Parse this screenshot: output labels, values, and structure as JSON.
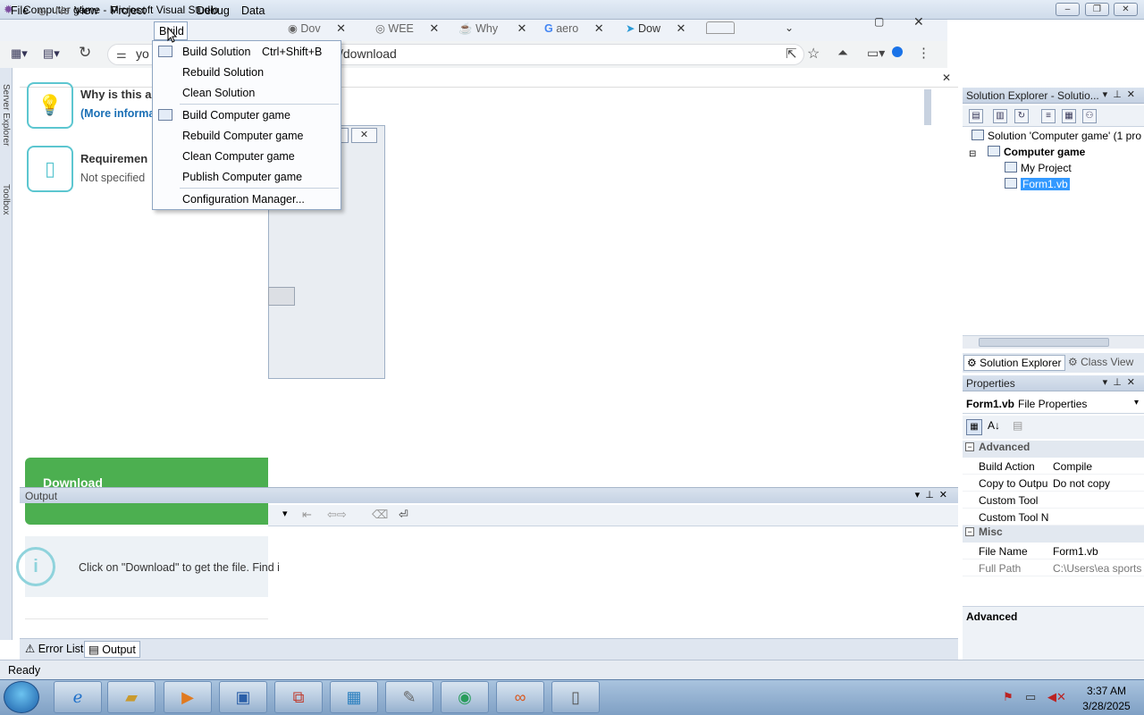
{
  "window": {
    "title": "Computer game - Microsoft Visual Studio",
    "min_label": "‒",
    "max_label": "❐",
    "close_label": "✕"
  },
  "menubar": {
    "file": "File",
    "new": "Ne",
    "view": "View",
    "project": "Project",
    "build": "Build",
    "debug": "Debug",
    "data": "Data"
  },
  "browser": {
    "tabs": [
      {
        "label": "Dov",
        "icon": "globe-icon"
      },
      {
        "label": "WEE",
        "icon": "web-icon"
      },
      {
        "label": "Why",
        "icon": "java-icon"
      },
      {
        "label": "aero",
        "icon": "google-icon"
      },
      {
        "label": "Dow",
        "icon": "download-icon"
      }
    ],
    "close_glyph": "✕",
    "address_prefix": "yo",
    "address_suffix": "/download"
  },
  "build_menu": {
    "items": [
      {
        "label": "Build Solution",
        "shortcut": "Ctrl+Shift+B"
      },
      {
        "label": "Rebuild Solution",
        "shortcut": ""
      },
      {
        "label": "Clean Solution",
        "shortcut": ""
      },
      {
        "label": "Build Computer game",
        "shortcut": ""
      },
      {
        "label": "Rebuild Computer game",
        "shortcut": ""
      },
      {
        "label": "Clean Computer game",
        "shortcut": ""
      },
      {
        "label": "Publish Computer game",
        "shortcut": ""
      },
      {
        "label": "Configuration Manager...",
        "shortcut": ""
      }
    ]
  },
  "page": {
    "why_title": "Why is this a",
    "more_info": "(More informa",
    "requirements_title": "Requiremen",
    "requirements_value": "Not specified",
    "download_label": "Download",
    "info_text": "Click on \"Download\" to get the file. Find i"
  },
  "left_strip": {
    "server_explorer": "Server Explorer",
    "toolbox": "Toolbox"
  },
  "output": {
    "title": "Output",
    "tab_error_list": "Error List",
    "tab_output": "Output"
  },
  "solution_explorer": {
    "title": "Solution Explorer - Solutio...",
    "solution": "Solution 'Computer game' (1 pro",
    "project": "Computer game",
    "my_project": "My Project",
    "form": "Form1.vb",
    "tab_solution": "Solution Explorer",
    "tab_class": "Class View"
  },
  "properties": {
    "title": "Properties",
    "object": "Form1.vb",
    "object_type": "File Properties",
    "categories": [
      {
        "name": "Advanced",
        "rows": [
          {
            "name": "Build Action",
            "value": "Compile"
          },
          {
            "name": "Copy to Outpu",
            "value": "Do not copy"
          },
          {
            "name": "Custom Tool",
            "value": ""
          },
          {
            "name": "Custom Tool N",
            "value": ""
          }
        ]
      },
      {
        "name": "Misc",
        "rows": [
          {
            "name": "File Name",
            "value": "Form1.vb"
          },
          {
            "name": "Full Path",
            "value": "C:\\Users\\ea sports i"
          }
        ]
      }
    ],
    "description_title": "Advanced"
  },
  "status": {
    "text": "Ready"
  },
  "taskbar": {
    "time": "3:37 AM",
    "date": "3/28/2025"
  }
}
